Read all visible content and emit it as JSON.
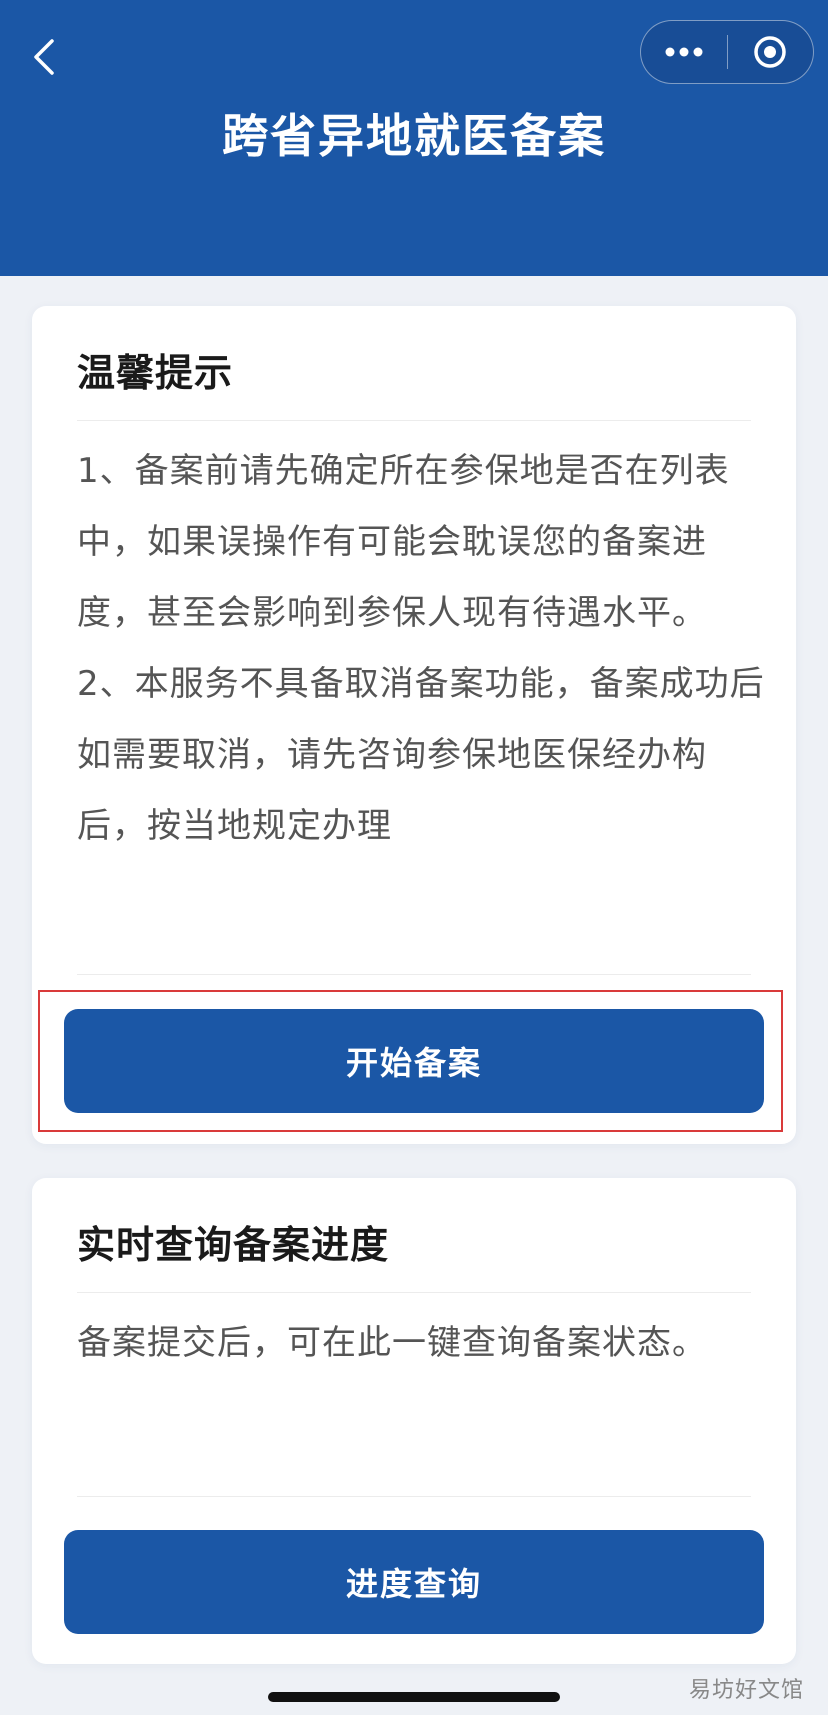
{
  "header": {
    "title": "跨省异地就医备案",
    "background_color": "#1b57a6"
  },
  "notice_card": {
    "title": "温馨提示",
    "paragraphs": [
      "1、备案前请先确定所在参保地是否在列表中，如果误操作有可能会耽误您的备案进度，甚至会影响到参保人现有待遇水平。",
      "2、本服务不具备取消备案功能，备案成功后如需要取消，请先咨询参保地医保经办构后，按当地规定办理"
    ],
    "button_label": "开始备案"
  },
  "query_card": {
    "title": "实时查询备案进度",
    "description": "备案提交后，可在此一键查询备案状态。",
    "button_label": "进度查询"
  },
  "watermark": "易坊好文馆",
  "colors": {
    "primary": "#1b57a6",
    "highlight_border": "#d93a3a"
  }
}
